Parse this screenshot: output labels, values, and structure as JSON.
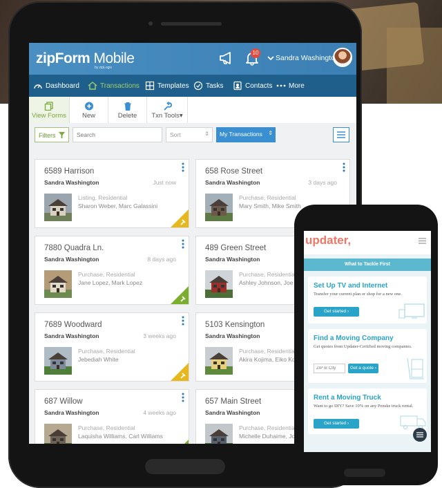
{
  "app": {
    "logo_main": "zipForm",
    "logo_mobile": "Mobile",
    "logo_sub": "by zipLogix",
    "notification_count": "10",
    "user_name": "Sandra Washington"
  },
  "nav": [
    "Dashboard",
    "Transactions",
    "Templates",
    "Tasks",
    "Contacts",
    "More"
  ],
  "toolbar": {
    "view_forms": "View Forms",
    "new": "New",
    "delete": "Delete",
    "txn_tools": "Txn Tools"
  },
  "filters": {
    "filters_label": "Filters",
    "search_placeholder": "Search",
    "sort_label": "Sort",
    "sort_arrows": "⇕",
    "my_transactions": "My Transactions"
  },
  "transactions": [
    {
      "address": "6589 Harrison",
      "agent": "Sandra Washington",
      "age": "Just now",
      "type": "Listing, Residential",
      "people": "Sharon Weber, Marc Galassini"
    },
    {
      "address": "658 Rose Street",
      "agent": "Sandra Washington",
      "age": "3 days ago",
      "type": "Purchase, Residential",
      "people": "Mary Smith, Mike Smith"
    },
    {
      "address": "7880 Quadra Ln.",
      "agent": "Sandra Washington",
      "age": "8 days ago",
      "type": "Purchase, Residential",
      "people": "Jane Lopez, Mark Lopez"
    },
    {
      "address": "489 Green Street",
      "agent": "Sandra Washington",
      "age": "",
      "type": "Purchase, Residential",
      "people": "Ashley Johnson, Joe Johns"
    },
    {
      "address": "7689 Woodward",
      "agent": "Sandra Washington",
      "age": "3 weeks ago",
      "type": "Purchase, Residential",
      "people": "Jebediah White"
    },
    {
      "address": "5103 Kensington",
      "agent": "Sandra Washington",
      "age": "",
      "type": "Purchase, Residential",
      "people": "Akira Kojima, Eiko Kojima"
    },
    {
      "address": "687 Willow",
      "agent": "Sandra Washington",
      "age": "4 weeks ago",
      "type": "Purchase, Residential",
      "people": "Laquisha Williams, Carl Williams"
    },
    {
      "address": "657 Main Street",
      "agent": "Sandra Washington",
      "age": "",
      "type": "Purchase, Residential",
      "people": "Michelle Duhaime, Joe Du"
    }
  ],
  "phone": {
    "logo": "updater,",
    "band": "What to Tackle First",
    "cards": [
      {
        "title": "Set Up TV and Internet",
        "body": "Transfer your current plan or shop for a new one.",
        "button": "Get started ›"
      },
      {
        "title": "Find a Moving Company",
        "body": "Get quotes from Updater-Certified moving companies.",
        "zip_placeholder": "ZIP or City",
        "button": "Get a quote ›"
      },
      {
        "title": "Rent a Moving Truck",
        "body": "Want to go DIY? Save 10% on any Penske truck rental.",
        "button": "Get started ›"
      }
    ]
  },
  "colors": {
    "header_blue": "#3b7fb4",
    "nav_dark_blue": "#1f5f8c",
    "active_green": "#9dd06a",
    "corner_yellow": "#e7b81c",
    "corner_green": "#7cae2e",
    "updater_coral": "#f07766",
    "updater_teal": "#2aa3c8"
  }
}
